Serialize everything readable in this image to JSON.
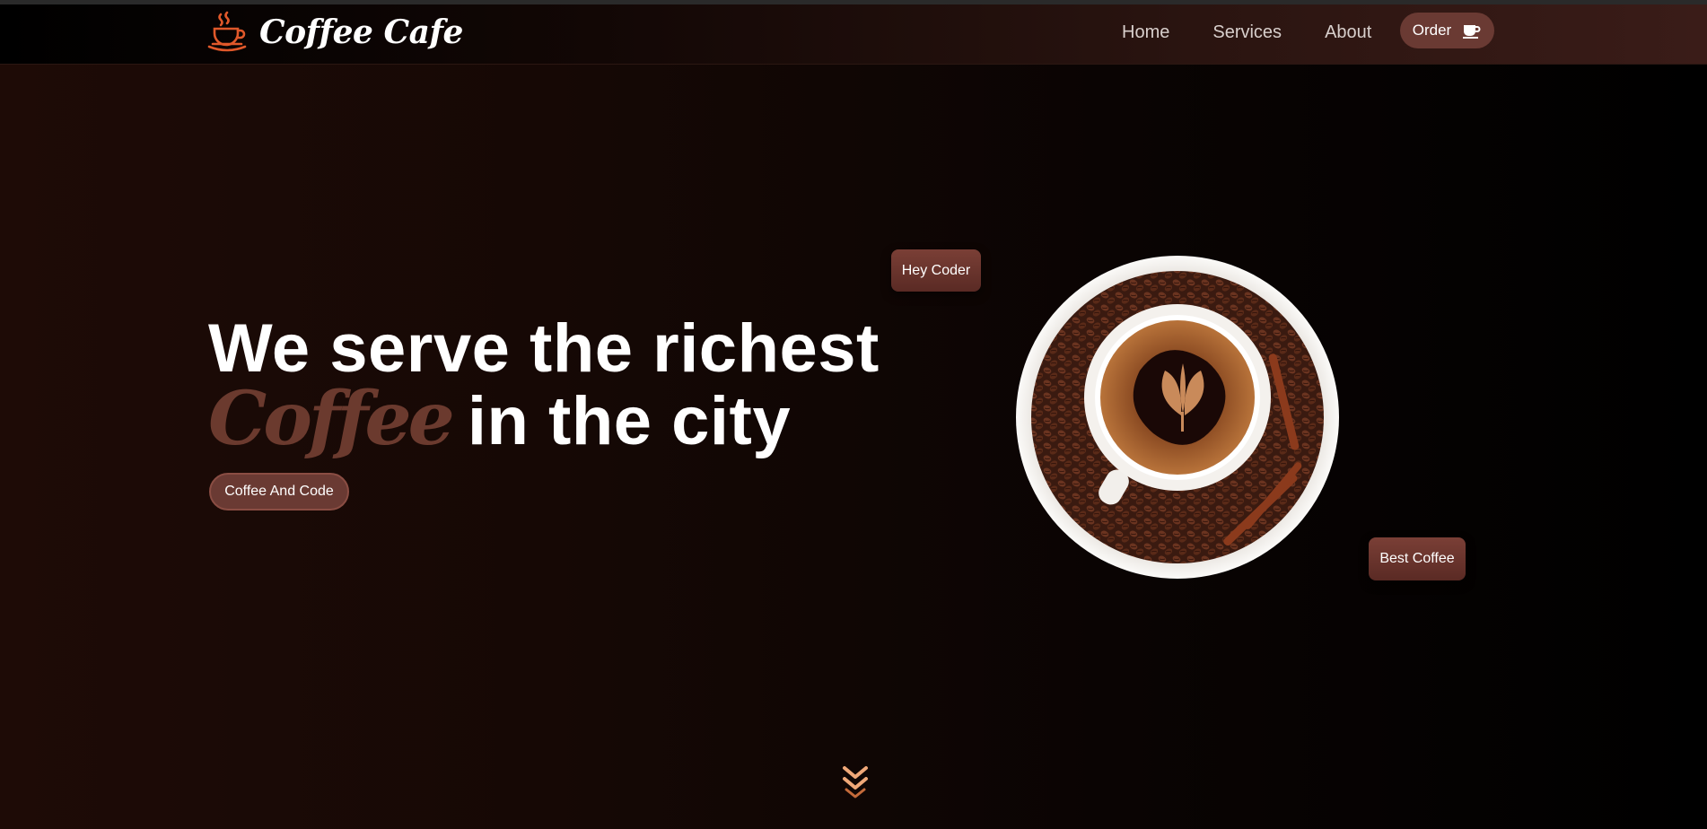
{
  "brand": {
    "name": "Coffee Cafe",
    "accent_color": "#e0582a"
  },
  "nav": {
    "items": [
      {
        "label": "Home"
      },
      {
        "label": "Services"
      },
      {
        "label": "About"
      }
    ],
    "order_label": "Order",
    "order_icon": "coffee-cup-icon"
  },
  "hero": {
    "line1": "We serve the richest",
    "script_word": "Coffee",
    "line2_rest": "in the city",
    "cta_label": "Coffee And Code",
    "tag_top": "Hey Coder",
    "tag_bottom": "Best Coffee",
    "image": "coffee-cup-on-beans-image",
    "scroll_icon": "chevron-double-down-icon"
  },
  "colors": {
    "button_bg": "#6a3a33",
    "script_text": "#6b3a2e",
    "scroll_arrow": "#f0a878"
  }
}
